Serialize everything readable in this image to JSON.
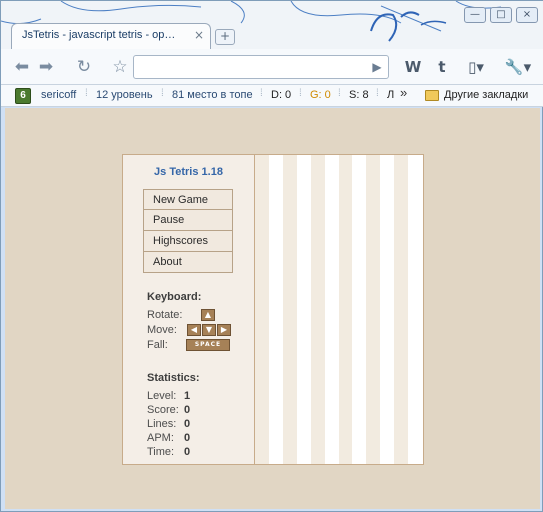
{
  "browser": {
    "tab_title": "JsTetris - javascript tetris - op…",
    "tab_close": "×",
    "new_tab": "+",
    "win_minimize": "—",
    "win_maximize": "□",
    "win_close": "×"
  },
  "bookmarks": {
    "badge": "6",
    "items": [
      "sericoff",
      "12 уровень",
      "81 место в топе",
      "D: 0",
      "G: 0",
      "S: 8",
      "Л"
    ],
    "more": "»",
    "other_folder": "Другие закладки",
    "g_color": "#d08a00"
  },
  "game": {
    "title": "Js Tetris 1.18",
    "menu": [
      "New Game",
      "Pause",
      "Highscores",
      "About"
    ],
    "keyboard_title": "Keyboard:",
    "rotate_label": "Rotate:",
    "move_label": "Move:",
    "fall_label": "Fall:",
    "space_label": "SPACE",
    "statistics_title": "Statistics:",
    "stats": [
      {
        "label": "Level:",
        "value": "1"
      },
      {
        "label": "Score:",
        "value": "0"
      },
      {
        "label": "Lines:",
        "value": "0"
      },
      {
        "label": "APM:",
        "value": "0"
      },
      {
        "label": "Time:",
        "value": "0"
      }
    ]
  }
}
